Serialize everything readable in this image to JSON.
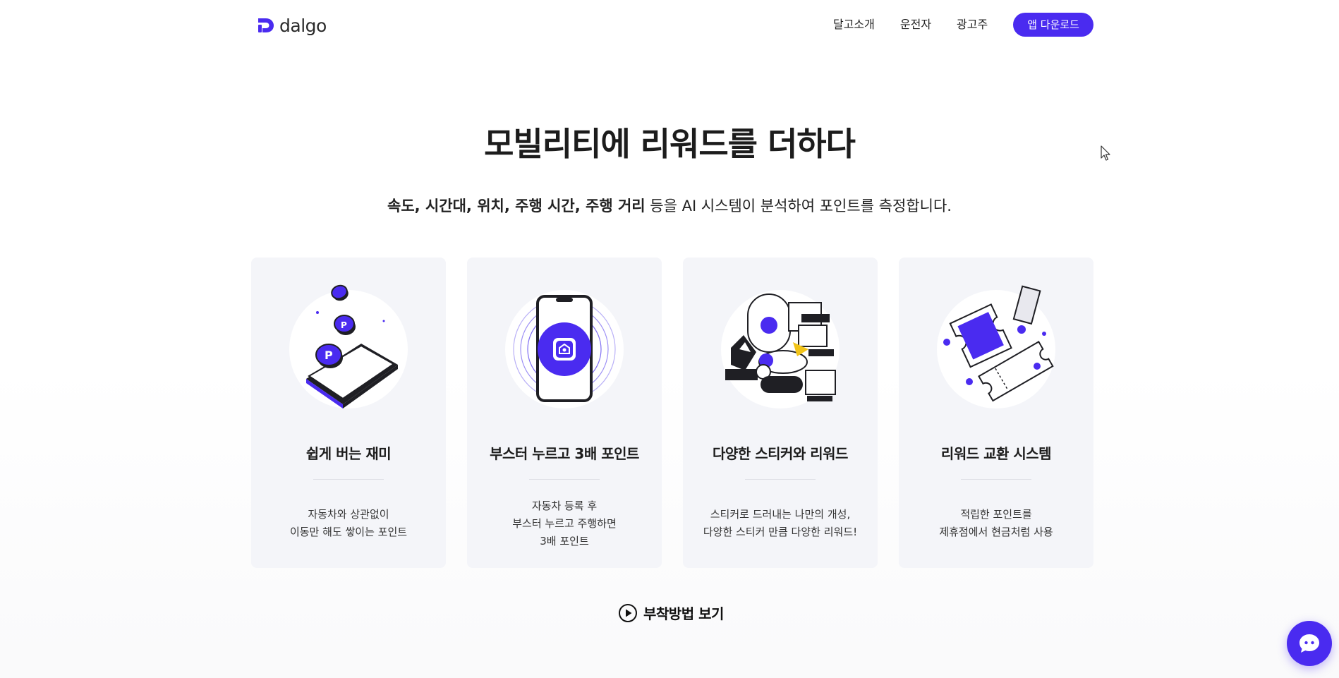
{
  "brand": {
    "name": "dalgo",
    "accent": "#4a2bf0"
  },
  "nav": {
    "items": [
      {
        "label": "달고소개"
      },
      {
        "label": "운전자"
      },
      {
        "label": "광고주"
      }
    ],
    "cta_label": "앱 다운로드"
  },
  "hero": {
    "title": "모빌리티에 리워드를 더하다",
    "subtitle_bold": "속도, 시간대, 위치, 주행 시간, 주행 거리",
    "subtitle_rest": " 등을 AI 시스템이 분석하여 포인트를 측정합니다."
  },
  "cards": [
    {
      "icon": "phone-coins-icon",
      "title": "쉽게 버는 재미",
      "desc": "자동차와 상관없이\n이동만 해도 쌓이는 포인트"
    },
    {
      "icon": "booster-phone-icon",
      "title": "부스터 누르고 3배 포인트",
      "desc": "자동차 등록 후\n부스터 누르고 주행하면\n3배 포인트"
    },
    {
      "icon": "stickers-icon",
      "title": "다양한 스티커와 리워드",
      "desc": "스티커로 드러내는 나만의 개성,\n다양한 스티커 만큼 다양한 리워드!"
    },
    {
      "icon": "tickets-icon",
      "title": "리워드 교환 시스템",
      "desc": "적립한 포인트를\n제휴점에서 현금처럼 사용"
    }
  ],
  "howto": {
    "label": "부착방법 보기",
    "icon": "play-circle-icon"
  },
  "chat": {
    "icon": "chat-bubble-icon"
  }
}
